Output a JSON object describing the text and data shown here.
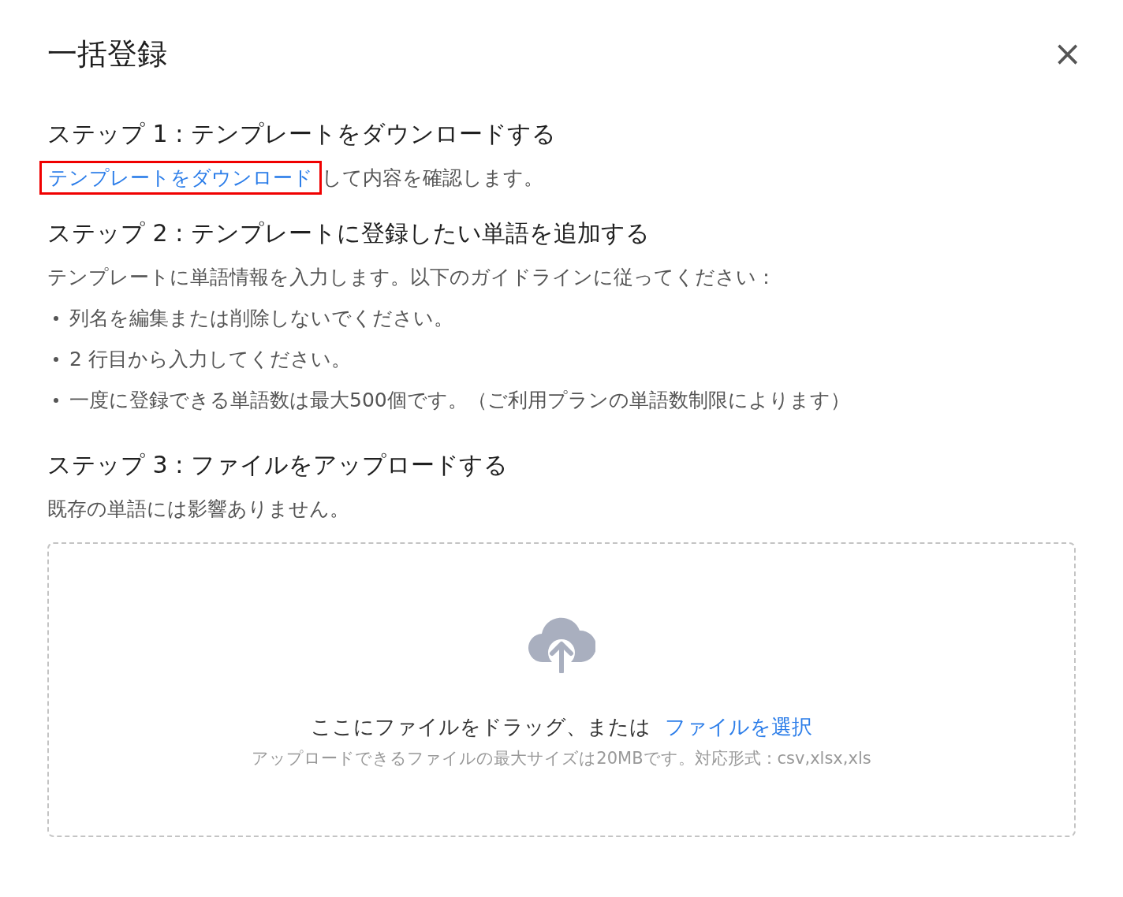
{
  "dialog": {
    "title": "一括登録",
    "close": "×"
  },
  "steps": [
    {
      "heading": "ステップ 1 : テンプレートをダウンロードする",
      "link": {
        "text": "テンプレートをダウンロード",
        "highlighted": true
      },
      "text": "して内容を確認します。"
    },
    {
      "heading": "ステップ 2 : テンプレートに登録したい単語を追加する",
      "text": "テンプレートに単語情報を入力します。以下のガイドラインに従ってください：",
      "bullets": [
        "列名を編集または削除しないでください。",
        "2 行目から入力してください。",
        "一度に登録できる単語数は最大500個です。（ご利用プランの単語数制限によります）"
      ]
    },
    {
      "heading": "ステップ 3 : ファイルをアップロードする",
      "text": "既存の単語には影響ありません。"
    }
  ],
  "upload": {
    "prompt": "ここにファイルをドラッグ、または",
    "link": "ファイルを選択",
    "hint": "アップロードできるファイルの最大サイズは20MBです。対応形式：csv,xlsx,xls"
  }
}
